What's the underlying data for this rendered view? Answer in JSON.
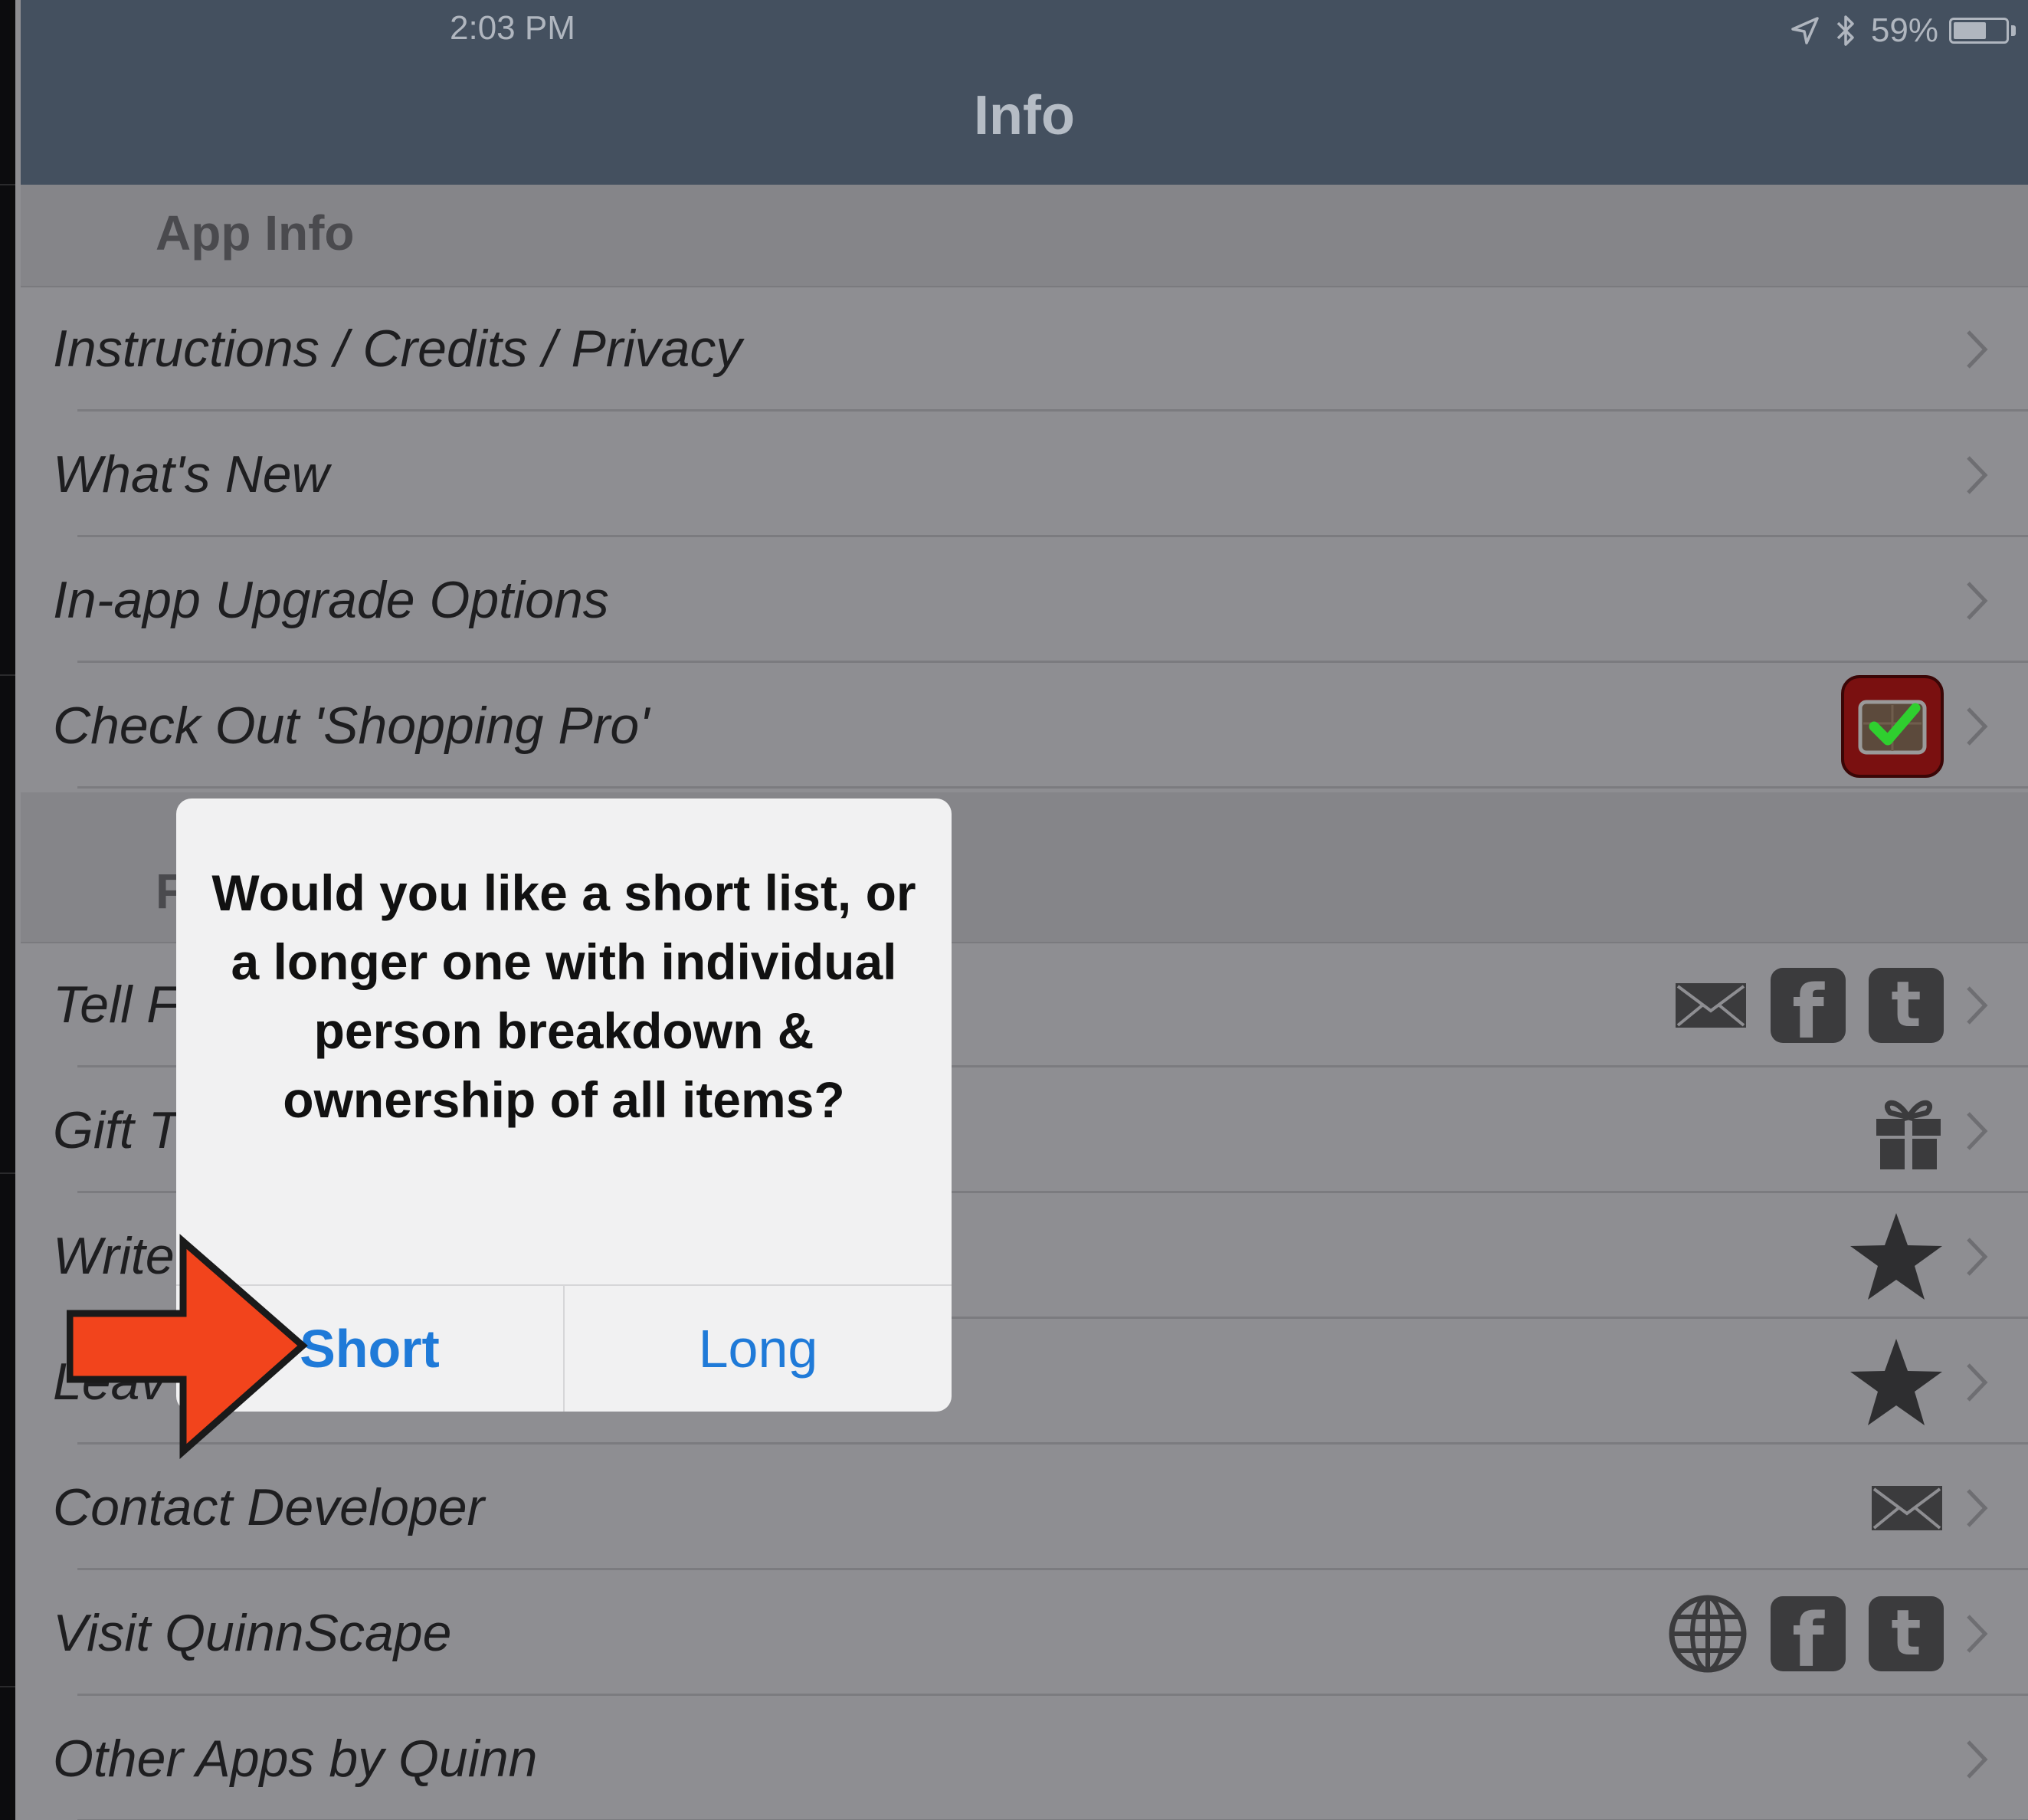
{
  "status_bar": {
    "time": "2:03 PM",
    "battery": "59%",
    "battery_level": 0.59
  },
  "nav": {
    "title": "Info"
  },
  "sections": [
    {
      "title": "App Info"
    },
    {
      "title": "F"
    }
  ],
  "rows": [
    {
      "label": "Instructions / Credits / Privacy",
      "icons": []
    },
    {
      "label": "What's New",
      "icons": []
    },
    {
      "label": "In-app Upgrade Options",
      "icons": []
    },
    {
      "label": "Check Out 'Shopping Pro'",
      "icons": [
        "shopping-pro-app-icon"
      ]
    },
    {
      "label": "Tell F",
      "icons": [
        "mail-icon",
        "facebook-icon",
        "twitter-icon"
      ]
    },
    {
      "label": "Gift T",
      "icons": [
        "gift-icon"
      ]
    },
    {
      "label": "Write",
      "icons": [
        "star-icon"
      ]
    },
    {
      "label": "Leav",
      "icons": [
        "star-icon"
      ]
    },
    {
      "label": "Contact Developer",
      "icons": [
        "mail-icon"
      ]
    },
    {
      "label": "Visit QuinnScape",
      "icons": [
        "globe-icon",
        "facebook-icon",
        "twitter-icon"
      ]
    },
    {
      "label": "Other Apps by Quinn",
      "icons": []
    }
  ],
  "dialog": {
    "message": "Would you like a short list, or a longer one with individual person breakdown & ownership of all items?",
    "short_label": "Short",
    "long_label": "Long"
  },
  "glyphs": {
    "facebook": "f",
    "twitter": "t"
  },
  "colors": {
    "nav_bg": "#44505f",
    "dialog_button": "#1f7ad8",
    "arrow": "#f2441c"
  }
}
